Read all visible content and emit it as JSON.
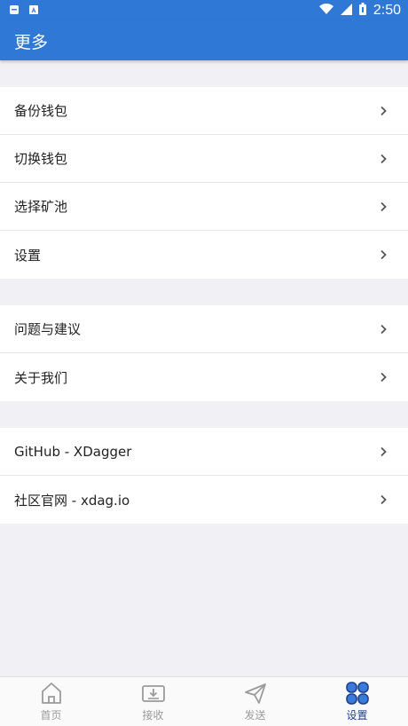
{
  "status_bar": {
    "time": "2:50",
    "icons": [
      "notification-icon",
      "a-icon",
      "wifi-icon",
      "signal-icon",
      "battery-icon"
    ]
  },
  "app_bar": {
    "title": "更多"
  },
  "groups": [
    {
      "items": [
        {
          "label": "备份钱包"
        },
        {
          "label": "切换钱包"
        },
        {
          "label": "选择矿池"
        },
        {
          "label": "设置"
        }
      ]
    },
    {
      "items": [
        {
          "label": "问题与建议"
        },
        {
          "label": "关于我们"
        }
      ]
    },
    {
      "items": [
        {
          "label": "GitHub - XDagger"
        },
        {
          "label": "社区官网 - xdag.io"
        }
      ]
    }
  ],
  "tabs": [
    {
      "label": "首页",
      "icon": "home-icon"
    },
    {
      "label": "接收",
      "icon": "receive-icon"
    },
    {
      "label": "发送",
      "icon": "send-icon"
    },
    {
      "label": "设置",
      "icon": "settings-grid-icon",
      "active": true
    }
  ],
  "colors": {
    "primary": "#2f78d6",
    "active_tab": "#1f3f8f",
    "background": "#f0f0f5"
  }
}
